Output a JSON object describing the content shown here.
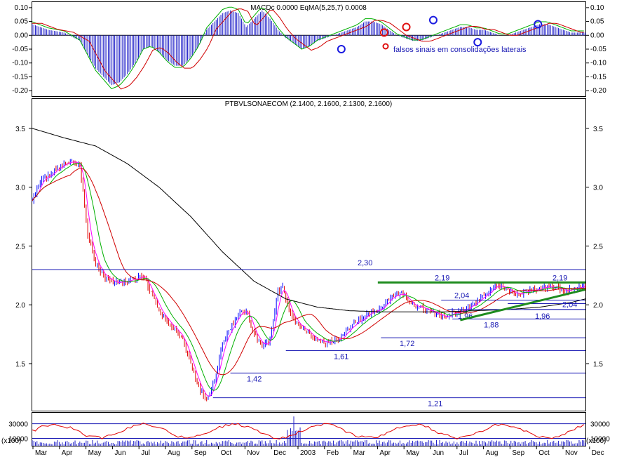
{
  "panels": {
    "macd_title": "MACDc 0.0000 EqMA(5,25,7) 0.0008",
    "price_title": "PTBVLSONAECOM (2.1400, 2.1600, 2.1300, 2.1600)",
    "volume_scale_label": "(x100)"
  },
  "annotation": {
    "text": "falsos sinais em consolidações laterais"
  },
  "colors": {
    "candle_up": "#0000ff",
    "candle_down": "#e00000",
    "ma_fast": "#ff00ff",
    "ma_mid": "#00b000",
    "ma_slow": "#d00000",
    "ma_long": "#000000",
    "level_line": "#1a1ab4",
    "trend_line": "#1e8c1e",
    "macd_hist": "#2020c8",
    "signal_marker_blue": "#1a1ae0",
    "signal_marker_red": "#e01010"
  },
  "chart_data": [
    {
      "type": "line",
      "name": "MACD",
      "ylim": [
        -0.22,
        0.12
      ],
      "y_ticks": [
        "0.10",
        "0.05",
        "0.00",
        "-0.05",
        "-0.10",
        "-0.15",
        "-0.20"
      ],
      "y_tick_values": [
        0.1,
        0.05,
        0.0,
        -0.05,
        -0.1,
        -0.15,
        -0.2
      ],
      "x": [
        0,
        10,
        20,
        30,
        40,
        50,
        55,
        60,
        65,
        70,
        75,
        80,
        85,
        90,
        95,
        100,
        105,
        110,
        115,
        120,
        125,
        130,
        135,
        140,
        145,
        150,
        155,
        160,
        165,
        170,
        175,
        180,
        185,
        190,
        195,
        200,
        205,
        210,
        215,
        220,
        225,
        230,
        235,
        240,
        245,
        250,
        255,
        260,
        265,
        270,
        275,
        280,
        285,
        290,
        295,
        300,
        305,
        310,
        315,
        320,
        325,
        330,
        335,
        340,
        345,
        349
      ],
      "hist": [
        0.04,
        0.02,
        0.01,
        -0.02,
        -0.12,
        -0.18,
        -0.17,
        -0.14,
        -0.1,
        -0.05,
        -0.04,
        -0.06,
        -0.09,
        -0.11,
        -0.11,
        -0.08,
        -0.04,
        0.02,
        0.05,
        0.08,
        0.09,
        0.08,
        0.03,
        0.06,
        0.09,
        0.06,
        0.02,
        -0.01,
        -0.03,
        -0.05,
        -0.04,
        -0.02,
        -0.01,
        0.0,
        0.01,
        0.02,
        0.03,
        0.05,
        0.05,
        0.04,
        0.02,
        0.0,
        -0.01,
        -0.02,
        -0.02,
        -0.01,
        0.0,
        0.01,
        0.02,
        0.03,
        0.03,
        0.02,
        0.02,
        0.01,
        0.0,
        0.0,
        0.01,
        0.02,
        0.03,
        0.04,
        0.04,
        0.03,
        0.02,
        0.01,
        0.01,
        0.01
      ],
      "signal_markers": [
        {
          "x": 195,
          "y": -0.05,
          "color": "blue"
        },
        {
          "x": 222,
          "y": 0.01,
          "color": "red"
        },
        {
          "x": 236,
          "y": 0.03,
          "color": "red"
        },
        {
          "x": 253,
          "y": 0.055,
          "color": "blue"
        },
        {
          "x": 281,
          "y": -0.025,
          "color": "blue"
        },
        {
          "x": 319,
          "y": 0.04,
          "color": "blue"
        }
      ]
    },
    {
      "type": "line",
      "name": "PTBVLSONAECOM",
      "ylim": [
        1.1,
        3.75
      ],
      "y_ticks": [
        "3.5",
        "3.0",
        "2.5",
        "2.0",
        "1.5"
      ],
      "y_tick_values": [
        3.5,
        3.0,
        2.5,
        2.0,
        1.5
      ],
      "x_ticks": [
        "Mar",
        "Apr",
        "May",
        "Jun",
        "Jul",
        "Aug",
        "Sep",
        "Oct",
        "Nov",
        "Dec",
        "2003",
        "Feb",
        "Mar",
        "Apr",
        "May",
        "Jun",
        "Jul",
        "Aug",
        "Sep",
        "Oct",
        "Nov",
        "Dec"
      ],
      "close_x": [
        0,
        5,
        10,
        15,
        20,
        25,
        30,
        35,
        40,
        45,
        50,
        55,
        60,
        65,
        70,
        75,
        80,
        85,
        90,
        95,
        100,
        105,
        110,
        115,
        118,
        121,
        125,
        130,
        135,
        140,
        145,
        150,
        155,
        158,
        162,
        166,
        170,
        175,
        180,
        185,
        190,
        195,
        200,
        205,
        210,
        215,
        220,
        225,
        230,
        235,
        240,
        245,
        250,
        255,
        260,
        265,
        270,
        275,
        280,
        285,
        290,
        295,
        300,
        305,
        310,
        315,
        320,
        325,
        330,
        335,
        340,
        345,
        349
      ],
      "close": [
        2.88,
        3.05,
        3.1,
        3.15,
        3.2,
        3.22,
        3.18,
        2.6,
        2.35,
        2.25,
        2.2,
        2.18,
        2.2,
        2.22,
        2.25,
        2.1,
        1.95,
        1.85,
        1.8,
        1.7,
        1.5,
        1.3,
        1.2,
        1.35,
        1.55,
        1.7,
        1.8,
        1.92,
        1.95,
        1.75,
        1.65,
        1.7,
        2.1,
        2.15,
        1.95,
        1.85,
        1.8,
        1.75,
        1.7,
        1.68,
        1.7,
        1.72,
        1.8,
        1.85,
        1.9,
        1.95,
        1.98,
        2.05,
        2.1,
        2.08,
        2.0,
        1.98,
        1.95,
        1.92,
        1.9,
        1.93,
        1.95,
        1.98,
        2.02,
        2.08,
        2.15,
        2.16,
        2.12,
        2.08,
        2.1,
        2.12,
        2.14,
        2.16,
        2.15,
        2.13,
        2.12,
        2.15,
        2.16
      ],
      "ma_long_x": [
        0,
        20,
        40,
        60,
        80,
        100,
        120,
        140,
        160,
        180,
        200,
        220,
        240,
        260,
        280,
        300,
        320,
        340,
        349
      ],
      "ma_long": [
        3.5,
        3.42,
        3.35,
        3.2,
        3.0,
        2.75,
        2.45,
        2.2,
        2.05,
        1.98,
        1.95,
        1.94,
        1.94,
        1.94,
        1.95,
        1.96,
        1.98,
        2.02,
        2.05
      ],
      "levels": [
        {
          "label": "2,30",
          "value": 2.3
        },
        {
          "label": "2,19",
          "value": 2.19
        },
        {
          "label": "2,04",
          "value": 2.04
        },
        {
          "label": "2,04",
          "value": 2.01
        },
        {
          "label": "1,96",
          "value": 1.96
        },
        {
          "label": "1,96",
          "value": 1.96
        },
        {
          "label": "1,88",
          "value": 1.88
        },
        {
          "label": "1,72",
          "value": 1.72
        },
        {
          "label": "1,61",
          "value": 1.61
        },
        {
          "label": "1,42",
          "value": 1.42
        },
        {
          "label": "1,21",
          "value": 1.21
        },
        {
          "label": "2,19",
          "value": 2.19
        }
      ]
    },
    {
      "type": "bar",
      "name": "Volume",
      "y_ticks": [
        "30000",
        "10000"
      ],
      "y_tick_values": [
        30000,
        10000
      ],
      "ylim": [
        0,
        45000
      ]
    }
  ]
}
